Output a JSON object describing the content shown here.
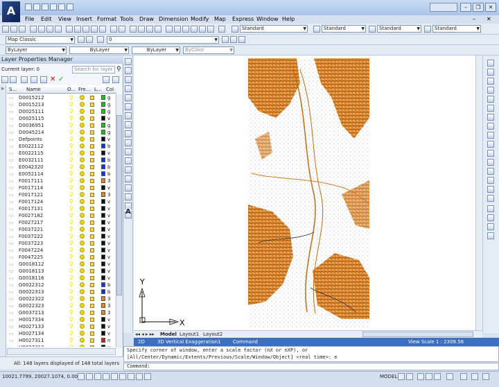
{
  "window": {
    "title": "",
    "min": "–",
    "max": "❐",
    "close": "✕",
    "menu_min": "–",
    "menu_close": "✕"
  },
  "menu": {
    "items": [
      "File",
      "Edit",
      "View",
      "Insert",
      "Format",
      "Tools",
      "Draw",
      "Dimension",
      "Modify",
      "Map",
      "Express",
      "Window",
      "Help"
    ]
  },
  "toolbar": {
    "dim_style_1": "Standard",
    "dim_style_2": "Standard",
    "dim_style_3": "Standard",
    "dim_style_4": "Standard",
    "workspace": "Map Classic",
    "layer_combo": "0",
    "color_combo": "ByLayer",
    "linetype_combo": "ByLayer",
    "lineweight_combo": "ByLayer",
    "plotstyle_combo": "ByColor"
  },
  "layer_panel": {
    "title": "Layer Properties Manager",
    "current_layer": "Current layer: 0",
    "search_placeholder": "Search for layer",
    "headers": {
      "status": "S...",
      "name": "Name",
      "on": "O...",
      "freeze": "Fre...",
      "lock": "L...",
      "color": "Col"
    },
    "layers": [
      {
        "name": "D0015212",
        "color": "#22bb22",
        "cn": "g"
      },
      {
        "name": "D0015213",
        "color": "#22bb22",
        "cn": "g"
      },
      {
        "name": "D0025111",
        "color": "#22bb22",
        "cn": "g"
      },
      {
        "name": "D0025115",
        "color": "#111111",
        "cn": "v"
      },
      {
        "name": "D0036951",
        "color": "#22bb22",
        "cn": "g"
      },
      {
        "name": "D0045214",
        "color": "#22bb22",
        "cn": "g"
      },
      {
        "name": "Defpoints",
        "color": "#111111",
        "cn": "v"
      },
      {
        "name": "E0022112",
        "color": "#1133dd",
        "cn": "b"
      },
      {
        "name": "E0022115",
        "color": "#111111",
        "cn": "v"
      },
      {
        "name": "E0032111",
        "color": "#1133dd",
        "cn": "b"
      },
      {
        "name": "E0042320",
        "color": "#1133dd",
        "cn": "b"
      },
      {
        "name": "E0052114",
        "color": "#1133dd",
        "cn": "b"
      },
      {
        "name": "F0017111",
        "color": "#dd8822",
        "cn": "3"
      },
      {
        "name": "F0017114",
        "color": "#111111",
        "cn": "v"
      },
      {
        "name": "F0017121",
        "color": "#dd8822",
        "cn": "3"
      },
      {
        "name": "F0017124",
        "color": "#111111",
        "cn": "v"
      },
      {
        "name": "F0017131",
        "color": "#111111",
        "cn": "v"
      },
      {
        "name": "F0027182",
        "color": "#111111",
        "cn": "v"
      },
      {
        "name": "F0027217",
        "color": "#111111",
        "cn": "v"
      },
      {
        "name": "F0037221",
        "color": "#111111",
        "cn": "v"
      },
      {
        "name": "F0037222",
        "color": "#111111",
        "cn": "v"
      },
      {
        "name": "F0037223",
        "color": "#111111",
        "cn": "v"
      },
      {
        "name": "F0047224",
        "color": "#111111",
        "cn": "v"
      },
      {
        "name": "F0047225",
        "color": "#111111",
        "cn": "v"
      },
      {
        "name": "G0018112",
        "color": "#111111",
        "cn": "v"
      },
      {
        "name": "G0018113",
        "color": "#111111",
        "cn": "v"
      },
      {
        "name": "G0018116",
        "color": "#111111",
        "cn": "v"
      },
      {
        "name": "G0022312",
        "color": "#1133dd",
        "cn": "b"
      },
      {
        "name": "G0022313",
        "color": "#1133dd",
        "cn": "b"
      },
      {
        "name": "G0022322",
        "color": "#dd8822",
        "cn": "3"
      },
      {
        "name": "G0022323",
        "color": "#dd8822",
        "cn": "3"
      },
      {
        "name": "G0037213",
        "color": "#dd8822",
        "cn": "3"
      },
      {
        "name": "H0017334",
        "color": "#111111",
        "cn": "v"
      },
      {
        "name": "H0027133",
        "color": "#111111",
        "cn": "v"
      },
      {
        "name": "H0027134",
        "color": "#111111",
        "cn": "v"
      },
      {
        "name": "H0027311",
        "color": "#cc2222",
        "cn": "n"
      },
      {
        "name": "H0027312",
        "color": "#111111",
        "cn": "v"
      }
    ],
    "status_text": "All: 148 layers displayed of 148 total layers"
  },
  "tabs": {
    "model": "Model",
    "layout1": "Layout1",
    "layout2": "Layout2"
  },
  "status2": {
    "twod": "2D",
    "threed": "3D",
    "vert": "Vertical Exaggeration1",
    "cmd": "Command",
    "view_scale": "View Scale 1 : 2309.56"
  },
  "command": {
    "line1": "Specify corner of window, enter a scale factor (nX or nXP), or",
    "line2": "[All/Center/Dynamic/Extents/Previous/Scale/Window/Object] <real time>: e",
    "prompt": "Command:"
  },
  "statusbar": {
    "coords": "10021.7799, 20027.1074, 0.0000",
    "model": "MODEL"
  },
  "ucs": {
    "x": "X",
    "y": "Y"
  }
}
